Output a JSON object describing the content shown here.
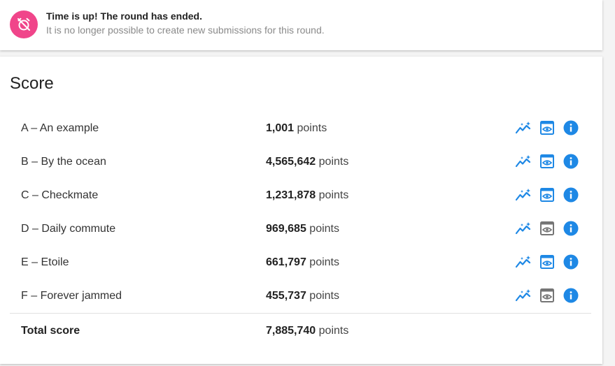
{
  "alert": {
    "title": "Time is up! The round has ended.",
    "message": "It is no longer possible to create new submissions for this round.",
    "icon": "alarm-off-icon",
    "icon_bg": "#f0458a"
  },
  "score": {
    "title": "Score",
    "points_unit": "points",
    "rows": [
      {
        "task": "A – An example",
        "points": "1,001",
        "view_active": true
      },
      {
        "task": "B – By the ocean",
        "points": "4,565,642",
        "view_active": true
      },
      {
        "task": "C – Checkmate",
        "points": "1,231,878",
        "view_active": true
      },
      {
        "task": "D – Daily commute",
        "points": "969,685",
        "view_active": false
      },
      {
        "task": "E – Etoile",
        "points": "661,797",
        "view_active": true
      },
      {
        "task": "F – Forever jammed",
        "points": "455,737",
        "view_active": false
      }
    ],
    "total_label": "Total score",
    "total_points": "7,885,740"
  },
  "colors": {
    "accent": "#1e88e5",
    "inactive": "#757575"
  }
}
